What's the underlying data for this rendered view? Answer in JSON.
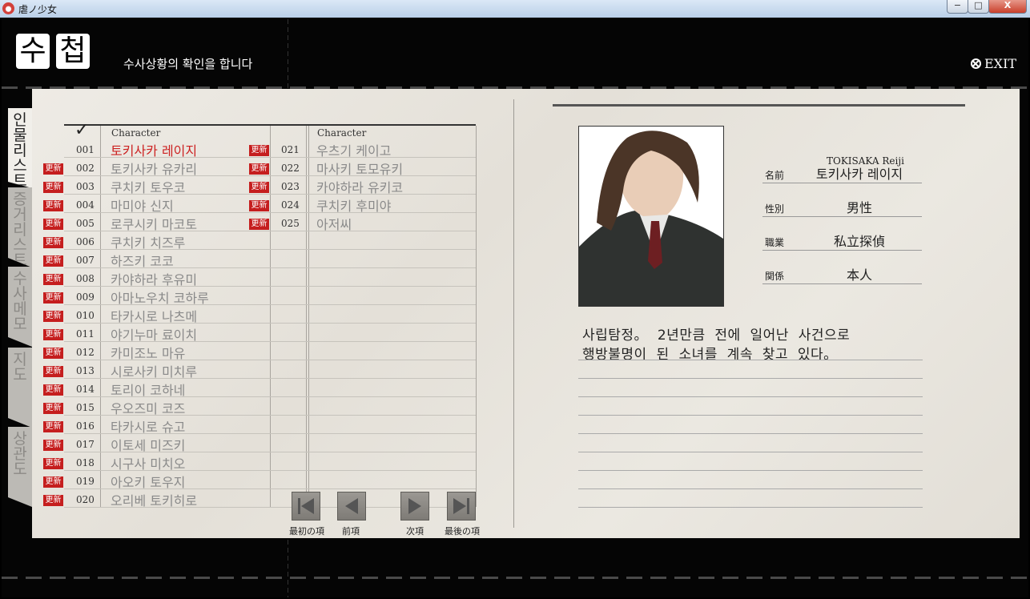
{
  "window": {
    "title": "虐ノ少女",
    "min": "−",
    "max": "□",
    "close": "X"
  },
  "header": {
    "title_chars": [
      "수",
      "첩"
    ],
    "subtitle": "수사상황의 확인을 합니다",
    "exit_label": "EXIT"
  },
  "tabs": [
    {
      "label": "인물리스트",
      "active": true
    },
    {
      "label": "증거리스트",
      "active": false
    },
    {
      "label": "수사메모",
      "active": false
    },
    {
      "label": "지도",
      "active": false
    },
    {
      "label": "상관도",
      "active": false
    }
  ],
  "list": {
    "column_header": "Character",
    "badge_label": "更新",
    "left": [
      {
        "num": "001",
        "name": "토키사카 레이지",
        "badge": false,
        "selected": true
      },
      {
        "num": "002",
        "name": "토키사카 유카리",
        "badge": true
      },
      {
        "num": "003",
        "name": "쿠치키 토우코",
        "badge": true
      },
      {
        "num": "004",
        "name": "마미야 신지",
        "badge": true
      },
      {
        "num": "005",
        "name": "로쿠시키 마코토",
        "badge": true
      },
      {
        "num": "006",
        "name": "쿠치키 치즈루",
        "badge": true
      },
      {
        "num": "007",
        "name": "하즈키 코코",
        "badge": true
      },
      {
        "num": "008",
        "name": "카야하라 후유미",
        "badge": true
      },
      {
        "num": "009",
        "name": "아마노우치 코하루",
        "badge": true
      },
      {
        "num": "010",
        "name": "타카시로 나츠메",
        "badge": true
      },
      {
        "num": "011",
        "name": "야기누마 료이치",
        "badge": true
      },
      {
        "num": "012",
        "name": "카미조노 마유",
        "badge": true
      },
      {
        "num": "013",
        "name": "시로사키 미치루",
        "badge": true
      },
      {
        "num": "014",
        "name": "토리이 코하네",
        "badge": true
      },
      {
        "num": "015",
        "name": "우오즈미 코즈",
        "badge": true
      },
      {
        "num": "016",
        "name": "타카시로 슈고",
        "badge": true
      },
      {
        "num": "017",
        "name": "이토세 미즈키",
        "badge": true
      },
      {
        "num": "018",
        "name": "시구사 미치오",
        "badge": true
      },
      {
        "num": "019",
        "name": "아오키 토우지",
        "badge": true
      },
      {
        "num": "020",
        "name": "오리베 토키히로",
        "badge": true
      }
    ],
    "right": [
      {
        "num": "021",
        "name": "우츠기 케이고",
        "badge": true
      },
      {
        "num": "022",
        "name": "마사키 토모유키",
        "badge": true
      },
      {
        "num": "023",
        "name": "카야하라 유키코",
        "badge": true
      },
      {
        "num": "024",
        "name": "쿠치키 후미야",
        "badge": true
      },
      {
        "num": "025",
        "name": "아저씨",
        "badge": true
      }
    ]
  },
  "nav": [
    {
      "label": "最初の項",
      "icon": "first-page-icon"
    },
    {
      "label": "前項",
      "icon": "prev-page-icon"
    },
    {
      "label": "次項",
      "icon": "next-page-icon"
    },
    {
      "label": "最後の項",
      "icon": "last-page-icon"
    }
  ],
  "profile": {
    "romaji": "TOKISAKA Reiji",
    "fields": [
      {
        "label": "名前",
        "value": "토키사카 레이지"
      },
      {
        "label": "性別",
        "value": "男性"
      },
      {
        "label": "職業",
        "value": "私立探偵"
      },
      {
        "label": "関係",
        "value": "本人"
      }
    ],
    "description": [
      "사립탐정。  2년만큼  전에  일어난  사건으로",
      "행방불명이  된  소녀를  계속  찾고  있다。"
    ]
  },
  "colors": {
    "badge": "#c51e1e",
    "selected": "#cc2222",
    "paper": "#e8e5de"
  }
}
